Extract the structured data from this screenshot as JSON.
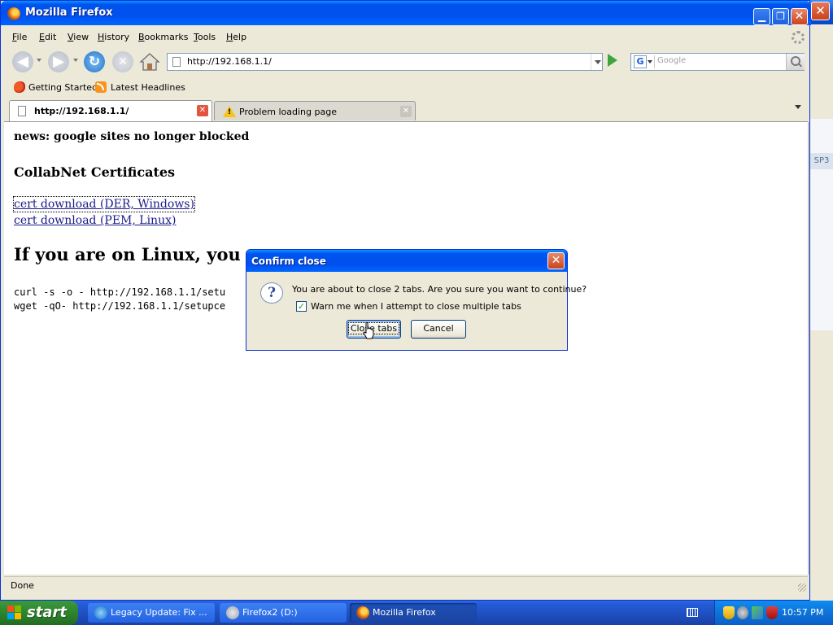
{
  "window": {
    "title": "Mozilla Firefox"
  },
  "menu": {
    "items": [
      {
        "label": "File",
        "accel": "F",
        "rest": "ile"
      },
      {
        "label": "Edit",
        "accel": "E",
        "rest": "dit"
      },
      {
        "label": "View",
        "accel": "V",
        "rest": "iew"
      },
      {
        "label": "History",
        "accel": "H",
        "rest": "istory"
      },
      {
        "label": "Bookmarks",
        "accel": "B",
        "rest": "ookmarks"
      },
      {
        "label": "Tools",
        "accel": "T",
        "rest": "ools"
      },
      {
        "label": "Help",
        "accel": "H",
        "rest": "elp"
      }
    ]
  },
  "navbar": {
    "url": "http://192.168.1.1/",
    "search_placeholder": "Google",
    "search_engine": "G"
  },
  "bookmarks": {
    "items": [
      "Getting Started",
      "Latest Headlines"
    ]
  },
  "tabs": [
    {
      "label": "http://192.168.1.1/",
      "active": true,
      "icon": "page-icon"
    },
    {
      "label": "Problem loading page",
      "active": false,
      "icon": "warning-icon"
    }
  ],
  "page": {
    "news": "news: google sites no longer blocked",
    "certs_heading": "CollabNet Certificates",
    "links": [
      "cert download (DER, Windows)",
      "cert download (PEM, Linux)"
    ],
    "linux_heading": "If you are on Linux, you can",
    "commands": [
      "curl -s -o - http://192.168.1.1/setu",
      "wget -qO- http://192.168.1.1/setupce"
    ]
  },
  "status": {
    "text": "Done"
  },
  "dialog": {
    "title": "Confirm close",
    "message": "You are about to close 2 tabs. Are you sure you want to continue?",
    "checkbox_label": "Warn me when I attempt to close multiple tabs",
    "checkbox_checked": true,
    "confirm_label": "Close tabs",
    "cancel_label": "Cancel"
  },
  "background_window": {
    "text": "SP3"
  },
  "taskbar": {
    "start_label": "start",
    "tasks": [
      {
        "label": "Legacy Update: Fix ...",
        "active": false
      },
      {
        "label": "Firefox2 (D:)",
        "active": false
      },
      {
        "label": "Mozilla Firefox",
        "active": true
      }
    ],
    "clock": "10:57 PM"
  },
  "colors": {
    "xp_title_blue": "#0053ee",
    "close_red": "#c9431c",
    "link": "#1a1a8b",
    "start_green": "#2f8a2f"
  }
}
